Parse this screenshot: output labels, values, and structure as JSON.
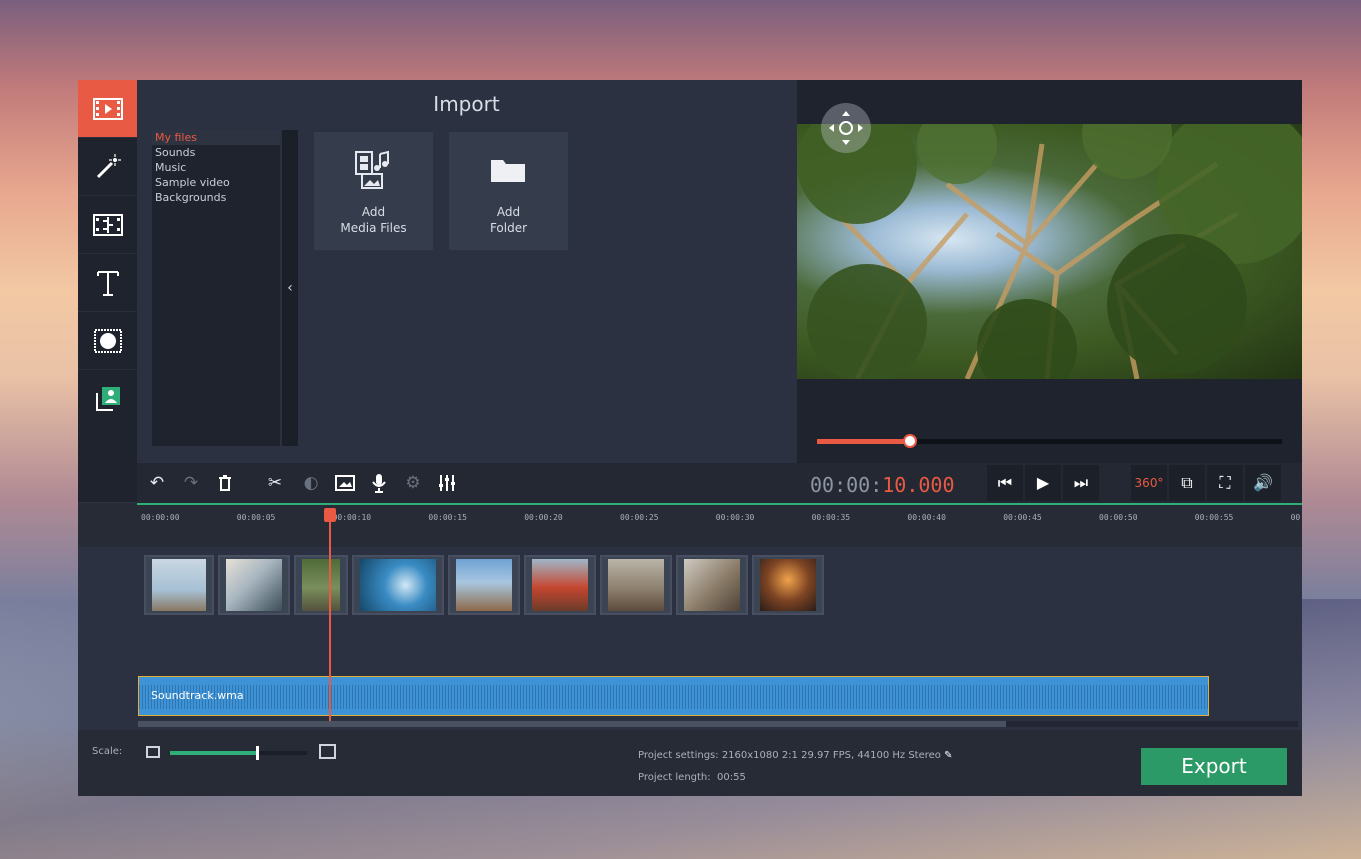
{
  "app": {
    "title": "Import"
  },
  "colors": {
    "accent": "#e85a43",
    "export": "#2b9a67",
    "panel": "#2b3140"
  },
  "sidebar": [
    {
      "icon": "film-import-icon",
      "active": true
    },
    {
      "icon": "magic-wand-icon"
    },
    {
      "icon": "transitions-icon"
    },
    {
      "icon": "titles-icon"
    },
    {
      "icon": "filters-icon"
    },
    {
      "icon": "more-tools-icon"
    }
  ],
  "files": {
    "items": [
      "My files",
      "Sounds",
      "Music",
      "Sample video",
      "Backgrounds"
    ],
    "selected": "My files",
    "collapse_glyph": "‹"
  },
  "tiles": [
    {
      "line1": "Add",
      "line2": "Media Files",
      "icon": "add-media-icon"
    },
    {
      "line1": "Add",
      "line2": "Folder",
      "icon": "folder-icon"
    }
  ],
  "player": {
    "time_prefix": "00:00:",
    "time_value": "10.000",
    "progress": 0.2
  },
  "timeline": {
    "ticks": [
      "00:00:00",
      "00:00:05",
      "00:00:10",
      "00:00:15",
      "00:00:20",
      "00:00:25",
      "00:00:30",
      "00:00:35",
      "00:00:40",
      "00:00:45",
      "00:00:50",
      "00:00:55",
      "00"
    ],
    "audio_name": "Soundtrack.wma",
    "playhead_time": "00:00:10"
  },
  "bottom": {
    "scale_label": "Scale:",
    "scale_level": 0.63,
    "project_settings": "Project settings:  2160x1080 2:1 29.97 FPS, 44100 Hz Stereo",
    "project_length_label": "Project length:",
    "project_length_value": "00:55",
    "export_label": "Export"
  }
}
